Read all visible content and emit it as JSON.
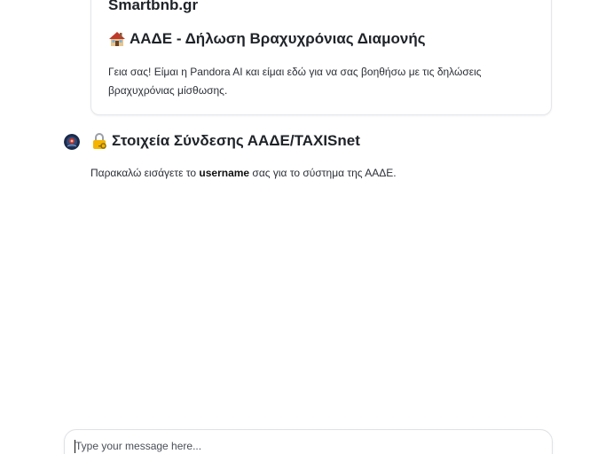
{
  "card": {
    "brand": "Smartbnb.gr",
    "title": "ΑΑΔΕ - Δήλωση Βραχυχρόνιας Διαμονής",
    "title_icon": "house-icon",
    "body": "Γεια σας! Είμαι η Pandora AI και είμαι εδώ για να σας βοηθήσω με τις δηλώσεις βραχυχρόνιας μίσθωσης."
  },
  "message": {
    "avatar_icon": "bot-avatar-icon",
    "title": "Στοιχεία Σύνδεσης ΑΑΔΕ/TAXISnet",
    "title_icon": "lock-key-icon",
    "body_before": "Παρακαλώ εισάγετε το ",
    "body_bold": "username",
    "body_after": " σας για το σύστημα της ΑΑΔΕ."
  },
  "composer": {
    "value": "",
    "placeholder": "Type your message here..."
  },
  "colors": {
    "text": "#1f2328",
    "border": "#e4e6ea",
    "background": "#ffffff"
  }
}
